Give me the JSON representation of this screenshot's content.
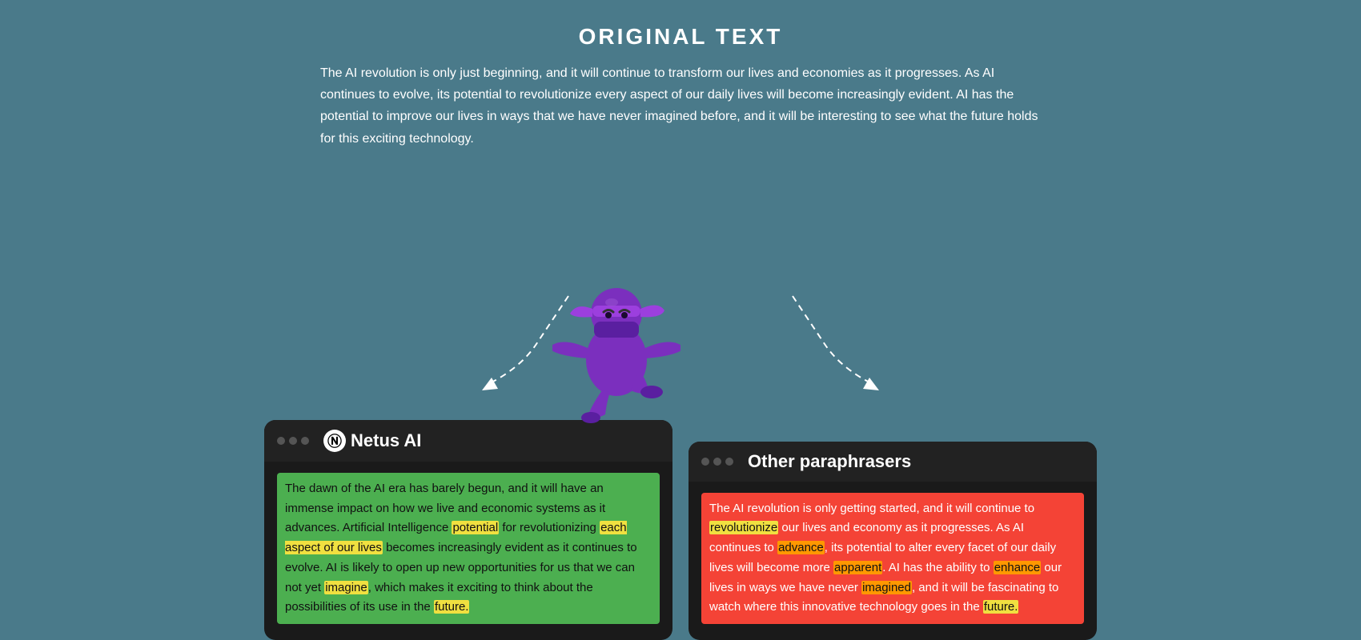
{
  "header": {
    "title": "ORIGINAL TEXT"
  },
  "original_text": "The AI revolution is only just beginning, and it will continue to transform our lives and economies as it progresses. As AI continues to evolve, its potential to revolutionize every aspect of our daily lives will become increasingly evident. AI has the potential to improve our lives in ways that we have never imagined before, and it will be interesting to see what the future holds for this exciting technology.",
  "netus_panel": {
    "title": "Netus AI",
    "logo_symbol": "N",
    "text_segments": [
      {
        "text": "The dawn of the AI era has barely begun, and it will have an immense impact on how we live and economic systems as it advances. Artificial Intelligence ",
        "highlight": false
      },
      {
        "text": "potential",
        "highlight": "yellow"
      },
      {
        "text": " for revolutionizing ",
        "highlight": false
      },
      {
        "text": "each aspect of our lives",
        "highlight": "yellow"
      },
      {
        "text": " becomes increasingly evident as it continues to evolve. AI is likely to open up new opportunities for us that we can not yet ",
        "highlight": false
      },
      {
        "text": "imagine",
        "highlight": "yellow"
      },
      {
        "text": ", which makes it exciting to think about the possibilities of its use in the ",
        "highlight": false
      },
      {
        "text": "future.",
        "highlight": "yellow"
      }
    ]
  },
  "other_panel": {
    "title": "Other paraphrasers",
    "text_segments": [
      {
        "text": "The AI revolution is only getting started,",
        "highlight": "red"
      },
      {
        "text": " and it will continue to ",
        "highlight": "red"
      },
      {
        "text": "revolutionize",
        "highlight": "yellow"
      },
      {
        "text": " our lives and economy as it progresses. As AI continues to ",
        "highlight": "red"
      },
      {
        "text": "advance",
        "highlight": "orange"
      },
      {
        "text": ", its potential to ",
        "highlight": "red"
      },
      {
        "text": "alter",
        "highlight": "red"
      },
      {
        "text": " every facet of our daily lives will become more ",
        "highlight": "red"
      },
      {
        "text": "apparent",
        "highlight": "orange"
      },
      {
        "text": ". AI has the ability to ",
        "highlight": "red"
      },
      {
        "text": "enhance",
        "highlight": "orange"
      },
      {
        "text": " our lives in ways we have never ",
        "highlight": "red"
      },
      {
        "text": "imagined",
        "highlight": "orange"
      },
      {
        "text": ", and it will be ",
        "highlight": "red"
      },
      {
        "text": "fascinating",
        "highlight": "red"
      },
      {
        "text": " to watch where this innovative technology goes in the future.",
        "highlight": "yellow"
      }
    ]
  },
  "ninja": {
    "aria": "ninja character mascot"
  }
}
